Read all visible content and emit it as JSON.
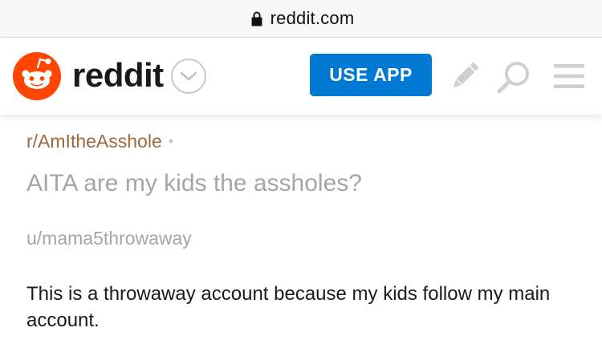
{
  "browser": {
    "url": "reddit.com"
  },
  "header": {
    "wordmark": "reddit",
    "use_app_label": "USE APP",
    "icons": {
      "logo": "reddit-alien-logo",
      "chevron": "chevron-down-icon",
      "pencil": "pencil-icon",
      "search": "search-icon",
      "menu": "menu-icon"
    },
    "colors": {
      "brand_orange": "#ff4500",
      "use_app_blue": "#0079d3"
    }
  },
  "post": {
    "subreddit": "r/AmItheAsshole",
    "separator": "•",
    "title": "AITA are my kids the assholes?",
    "author": "u/mama5throwaway",
    "body": "This is a throwaway account because my kids follow my main account."
  }
}
